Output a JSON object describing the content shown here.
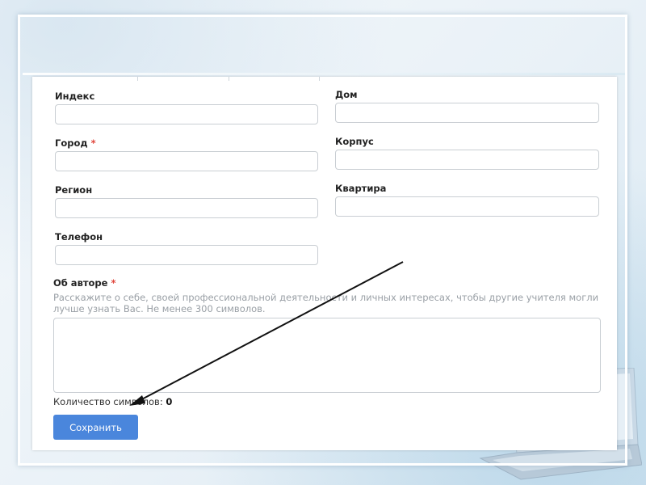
{
  "form": {
    "index": {
      "label": "Индекс",
      "value": "",
      "required": false
    },
    "city": {
      "label": "Город",
      "value": "",
      "required": true
    },
    "region": {
      "label": "Регион",
      "value": "",
      "required": false
    },
    "phone": {
      "label": "Телефон",
      "value": "",
      "required": false
    },
    "house": {
      "label": "Дом",
      "value": "",
      "required": false
    },
    "building": {
      "label": "Корпус",
      "value": "",
      "required": false
    },
    "apartment": {
      "label": "Квартира",
      "value": "",
      "required": false
    },
    "required_mark": "*",
    "about": {
      "label": "Об авторе",
      "hint": "Расскажите о себе, своей профессиональной деятельности и личных интересах, чтобы другие учителя могли лучше узнать Вас. Не менее 300 символов.",
      "value": "",
      "required": true
    },
    "counter": {
      "label": "Количество символов:",
      "value": "0"
    },
    "save_label": "Сохранить"
  },
  "colors": {
    "accent": "#4a86dc",
    "required": "#e0443a",
    "hint": "#9aa0a6",
    "arrow": "#111111"
  }
}
